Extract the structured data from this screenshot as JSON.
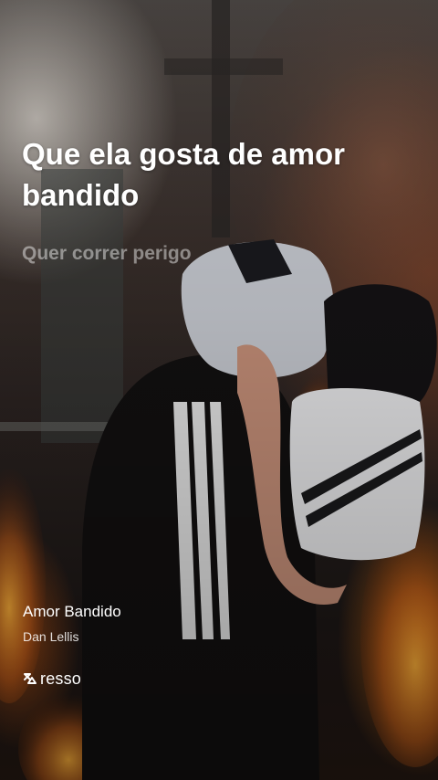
{
  "lyrics": {
    "current_line": "Que ela gosta de amor bandido",
    "next_line": "Quer correr perigo"
  },
  "track": {
    "title": "Amor Bandido",
    "artist": "Dan Lellis"
  },
  "brand": {
    "name": "resso",
    "icon": "resso-logo-icon"
  }
}
